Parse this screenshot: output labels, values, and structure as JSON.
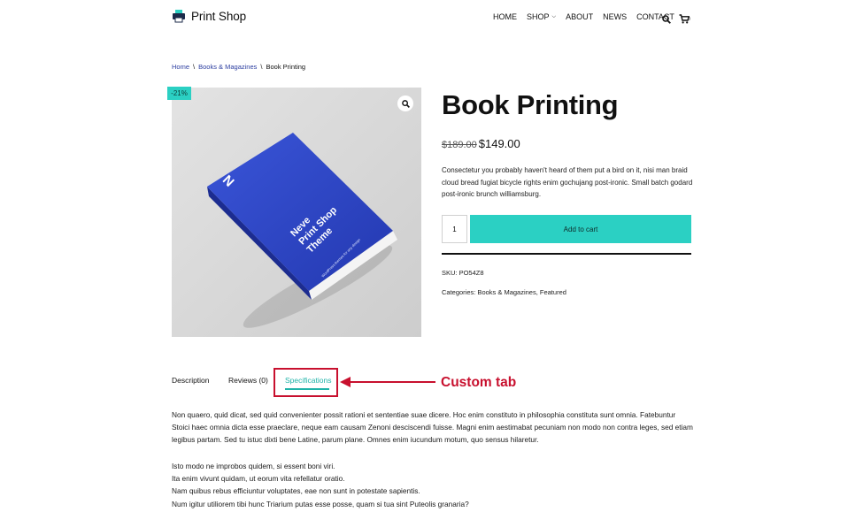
{
  "header": {
    "logo_text": "Print Shop",
    "nav": [
      {
        "label": "HOME"
      },
      {
        "label": "SHOP",
        "has_dropdown": true
      },
      {
        "label": "ABOUT"
      },
      {
        "label": "NEWS"
      },
      {
        "label": "CONTACT"
      }
    ],
    "cart_count": "0"
  },
  "breadcrumb": {
    "home": "Home",
    "sep1": "\\",
    "category": "Books & Magazines",
    "sep2": "\\",
    "current": "Book Printing"
  },
  "product": {
    "sale_badge": "-21%",
    "title": "Book Printing",
    "price_old": "$189.00",
    "price_new": "$149.00",
    "description": "Consectetur you probably haven't heard of them put a bird on it, nisi man braid cloud bread fugiat bicycle rights enim gochujang post-ironic. Small batch godard post-ironic brunch williamsburg.",
    "quantity": "1",
    "add_to_cart": "Add to cart",
    "sku": "SKU: PO54Z8",
    "categories": "Categories: Books & Magazines, Featured",
    "book_cover_line1": "Neve",
    "book_cover_line2": "Print Shop",
    "book_cover_line3": "Theme",
    "book_cover_small": "WordPress themes for any design"
  },
  "tabs": [
    {
      "label": "Description"
    },
    {
      "label": "Reviews (0)"
    },
    {
      "label": "Specifications",
      "active": true
    }
  ],
  "annotation": {
    "callout": "Custom tab"
  },
  "content": {
    "paragraph": "Non quaero, quid dicat, sed quid convenienter possit rationi et sententiae suae dicere. Hoc enim constituto in philosophia constituta sunt omnia. Fatebuntur Stoici haec omnia dicta esse praeclare, neque eam causam Zenoni desciscendi fuisse. Magni enim aestimabat pecuniam non modo non contra leges, sed etiam legibus partam. Sed tu istuc dixti bene Latine, parum plane. Omnes enim iucundum motum, quo sensus hilaretur.",
    "lines": [
      "Isto modo ne improbos quidem, si essent boni viri.",
      "Ita enim vivunt quidam, ut eorum vita refellatur oratio.",
      "Nam quibus rebus efficiuntur voluptates, eae non sunt in potestate sapientis.",
      "Num igitur utiliorem tibi hunc Triarium putas esse posse, quam si tua sint Puteolis granaria?"
    ]
  },
  "colors": {
    "accent": "#2bd0c3",
    "accent_text": "#1fb3a8",
    "annotation_red": "#c8102e",
    "book_blue": "#2f47c8"
  }
}
